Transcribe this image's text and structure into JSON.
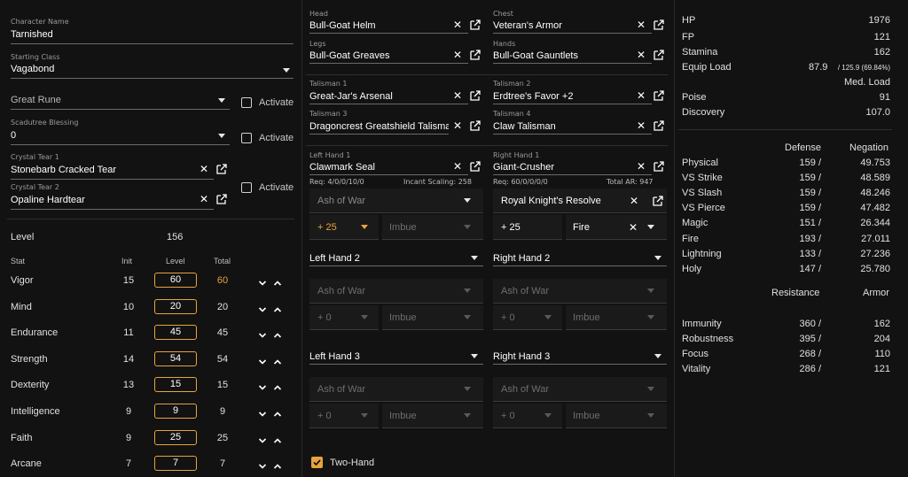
{
  "left": {
    "character_name": {
      "label": "Character Name",
      "value": "Tarnished"
    },
    "starting_class": {
      "label": "Starting Class",
      "value": "Vagabond"
    },
    "great_rune": {
      "value": "Great Rune",
      "activate": "Activate"
    },
    "scadutree": {
      "label": "Scadutree Blessing",
      "value": "0",
      "activate": "Activate"
    },
    "crystal_tear_1": {
      "label": "Crystal Tear 1",
      "value": "Stonebarb Cracked Tear"
    },
    "crystal_tear_2": {
      "label": "Crystal Tear 2",
      "value": "Opaline Hardtear",
      "activate": "Activate"
    },
    "level_label": "Level",
    "level_value": "156",
    "headers": {
      "stat": "Stat",
      "init": "Init",
      "level": "Level",
      "total": "Total"
    },
    "stats": [
      {
        "name": "Vigor",
        "init": "15",
        "level": "60",
        "total": "60",
        "highlight": true
      },
      {
        "name": "Mind",
        "init": "10",
        "level": "20",
        "total": "20",
        "highlight": false
      },
      {
        "name": "Endurance",
        "init": "11",
        "level": "45",
        "total": "45",
        "highlight": false
      },
      {
        "name": "Strength",
        "init": "14",
        "level": "54",
        "total": "54",
        "highlight": false
      },
      {
        "name": "Dexterity",
        "init": "13",
        "level": "15",
        "total": "15",
        "highlight": false
      },
      {
        "name": "Intelligence",
        "init": "9",
        "level": "9",
        "total": "9",
        "highlight": false
      },
      {
        "name": "Faith",
        "init": "9",
        "level": "25",
        "total": "25",
        "highlight": false
      },
      {
        "name": "Arcane",
        "init": "7",
        "level": "7",
        "total": "7",
        "highlight": false
      }
    ]
  },
  "middle": {
    "head": {
      "label": "Head",
      "value": "Bull-Goat Helm"
    },
    "chest": {
      "label": "Chest",
      "value": "Veteran's Armor"
    },
    "legs": {
      "label": "Legs",
      "value": "Bull-Goat Greaves"
    },
    "hands": {
      "label": "Hands",
      "value": "Bull-Goat Gauntlets"
    },
    "talisman1": {
      "label": "Talisman 1",
      "value": "Great-Jar's Arsenal"
    },
    "talisman2": {
      "label": "Talisman 2",
      "value": "Erdtree's Favor +2"
    },
    "talisman3": {
      "label": "Talisman 3",
      "value": "Dragoncrest Greatshield Talisman"
    },
    "talisman4": {
      "label": "Talisman 4",
      "value": "Claw Talisman"
    },
    "left_hand_1": {
      "label": "Left Hand 1",
      "value": "Clawmark Seal",
      "req": "Req: 4/0/0/10/0",
      "extra": "Incant Scaling: 258",
      "ash": "Ash of War",
      "upgrade": "+ 25",
      "imbue": "Imbue"
    },
    "right_hand_1": {
      "label": "Right Hand 1",
      "value": "Giant-Crusher",
      "req": "Req: 60/0/0/0/0",
      "extra": "Total AR: 947",
      "ash": "Royal Knight's Resolve",
      "upgrade": "+ 25",
      "imbue": "Fire"
    },
    "left_hand_2": {
      "value": "Left Hand 2",
      "ash": "Ash of War",
      "upgrade": "+ 0",
      "imbue": "Imbue"
    },
    "right_hand_2": {
      "value": "Right Hand 2",
      "ash": "Ash of War",
      "upgrade": "+ 0",
      "imbue": "Imbue"
    },
    "left_hand_3": {
      "value": "Left Hand 3",
      "ash": "Ash of War",
      "upgrade": "+ 0",
      "imbue": "Imbue"
    },
    "right_hand_3": {
      "value": "Right Hand 3",
      "ash": "Ash of War",
      "upgrade": "+ 0",
      "imbue": "Imbue"
    },
    "two_hand": "Two-Hand"
  },
  "right": {
    "hp": {
      "label": "HP",
      "value": "1976"
    },
    "fp": {
      "label": "FP",
      "value": "121"
    },
    "stamina": {
      "label": "Stamina",
      "value": "162"
    },
    "equip_load": {
      "label": "Equip Load",
      "value": "87.9",
      "max": "/ 125.9 (69.84%)",
      "class": "Med. Load"
    },
    "poise": {
      "label": "Poise",
      "value": "91"
    },
    "discovery": {
      "label": "Discovery",
      "value": "107.0"
    },
    "def_headers": {
      "defense": "Defense",
      "negation": "Negation"
    },
    "defense": [
      {
        "name": "Physical",
        "def": "159 /",
        "neg": "49.753"
      },
      {
        "name": "VS Strike",
        "def": "159 /",
        "neg": "48.589"
      },
      {
        "name": "VS Slash",
        "def": "159 /",
        "neg": "48.246"
      },
      {
        "name": "VS Pierce",
        "def": "159 /",
        "neg": "47.482"
      },
      {
        "name": "Magic",
        "def": "151 /",
        "neg": "26.344"
      },
      {
        "name": "Fire",
        "def": "193 /",
        "neg": "27.011"
      },
      {
        "name": "Lightning",
        "def": "133 /",
        "neg": "27.236"
      },
      {
        "name": "Holy",
        "def": "147 /",
        "neg": "25.780"
      }
    ],
    "res_headers": {
      "resistance": "Resistance",
      "armor": "Armor"
    },
    "resistance": [
      {
        "name": "Immunity",
        "res": "360 /",
        "armor": "162"
      },
      {
        "name": "Robustness",
        "res": "395 /",
        "armor": "204"
      },
      {
        "name": "Focus",
        "res": "268 /",
        "armor": "110"
      },
      {
        "name": "Vitality",
        "res": "286 /",
        "armor": "121"
      }
    ]
  },
  "colors": {
    "accent": "#e8a33c",
    "background": "#121212",
    "panel_field": "#1a1a1a"
  }
}
